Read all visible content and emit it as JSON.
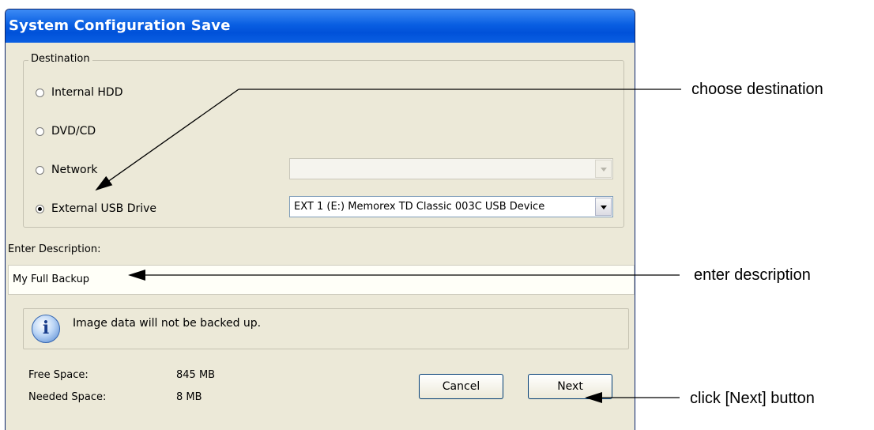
{
  "window": {
    "title": "System Configuration Save"
  },
  "destination": {
    "group_label": "Destination",
    "options": [
      {
        "label": "Internal HDD",
        "selected": false
      },
      {
        "label": "DVD/CD",
        "selected": false
      },
      {
        "label": "Network",
        "selected": false
      },
      {
        "label": "External USB Drive",
        "selected": true
      }
    ],
    "network_select": {
      "value": "",
      "enabled": false
    },
    "usb_select": {
      "value": "EXT 1 (E:) Memorex TD Classic 003C USB Device",
      "enabled": true
    }
  },
  "description": {
    "label": "Enter Description:",
    "value": "My Full Backup"
  },
  "info": {
    "icon": "info-icon",
    "message": "Image data will not be backed up."
  },
  "space": {
    "free_label": "Free Space:",
    "free_value": "845 MB",
    "needed_label": "Needed Space:",
    "needed_value": "8 MB"
  },
  "buttons": {
    "cancel": "Cancel",
    "next": "Next"
  },
  "annotations": {
    "choose": "choose destination",
    "enter": "enter description",
    "click": "click [Next] button"
  }
}
